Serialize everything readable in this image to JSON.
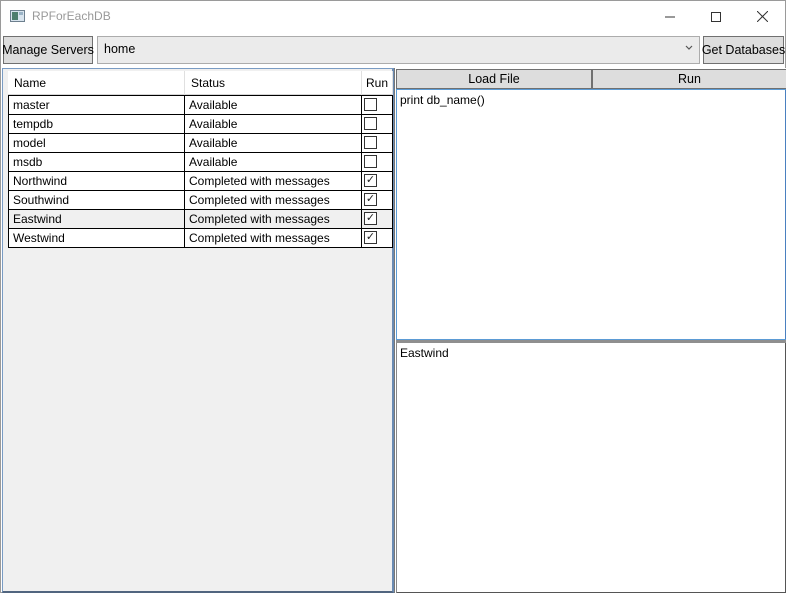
{
  "window": {
    "title": "RPForEachDB",
    "controls": {
      "minimize": "—",
      "maximize": "☐",
      "close": "✕"
    }
  },
  "toolbar": {
    "manage_servers_label": "Manage Servers",
    "server_combo_value": "home",
    "combo_arrow": "⌄",
    "get_databases_label": "Get Databases"
  },
  "grid": {
    "columns": [
      "Name",
      "Status",
      "Run"
    ],
    "rows": [
      {
        "name": "master",
        "status": "Available",
        "run": false,
        "check": ""
      },
      {
        "name": "tempdb",
        "status": "Available",
        "run": false,
        "check": ""
      },
      {
        "name": "model",
        "status": "Available",
        "run": false,
        "check": ""
      },
      {
        "name": "msdb",
        "status": "Available",
        "run": false,
        "check": ""
      },
      {
        "name": "Northwind",
        "status": "Completed with messages",
        "run": true,
        "check": "✓"
      },
      {
        "name": "Southwind",
        "status": "Completed with messages",
        "run": true,
        "check": "✓"
      },
      {
        "name": "Eastwind",
        "status": "Completed with messages",
        "run": true,
        "check": "✓",
        "selected": true
      },
      {
        "name": "Westwind",
        "status": "Completed with messages",
        "run": true,
        "check": "✓"
      }
    ]
  },
  "script_panel": {
    "load_file_label": "Load File",
    "run_label": "Run",
    "script_text": "print db_name()",
    "output_text": "Eastwind"
  }
}
